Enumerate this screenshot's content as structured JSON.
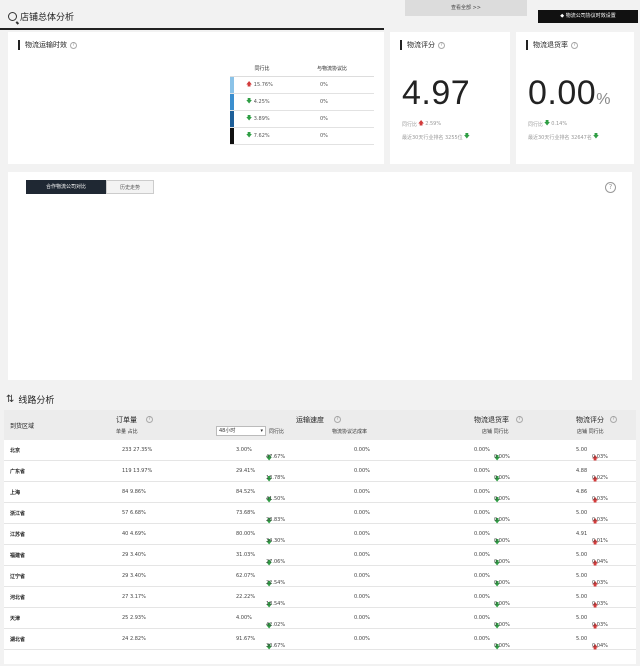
{
  "header": {
    "title": "店铺总体分析",
    "view_all": "查看全部 >>",
    "settings": "物流公司协议时效设置"
  },
  "transport": {
    "title": "物流运输时效",
    "help": "?",
    "table_headers": [
      "同行比",
      "与物流协议比"
    ],
    "rows": [
      {
        "trend": "up",
        "peer": "15.76%",
        "agreement": "0%",
        "bar_color": "#8bc3e8"
      },
      {
        "trend": "down",
        "peer": "4.25%",
        "agreement": "0%",
        "bar_color": "#3b8fcf"
      },
      {
        "trend": "down",
        "peer": "3.89%",
        "agreement": "0%",
        "bar_color": "#1e5f99"
      },
      {
        "trend": "down",
        "peer": "7.62%",
        "agreement": "0%",
        "bar_color": "#111111"
      }
    ]
  },
  "rating": {
    "title": "物流评分",
    "value": "4.97",
    "peer_label": "同行比",
    "peer_value": "2.59%",
    "rank_label": "最近30天行业排名 3255位"
  },
  "return_rate": {
    "title": "物流退货率",
    "value": "0.00",
    "unit": "%",
    "peer_label": "同行比",
    "peer_value": "0.14%",
    "rank_label": "最近30天行业排名 32647名"
  },
  "tabs": {
    "compare": "合作物流公司对比",
    "history": "历史走势"
  },
  "routes": {
    "title": "线路分析",
    "headers": {
      "region": "到货区域",
      "orders": "订单量",
      "orders_sub": "单量 占比",
      "speed": "运输速度",
      "speed_select": "48小时",
      "peer_ratio": "同行比",
      "agreement_rate": "物流协议达成率",
      "return_rate": "物流退货率",
      "store_peer": "店铺 同行比",
      "score": "物流评分",
      "store_peer2": "店铺 同行比"
    },
    "rows": [
      {
        "region": "北京",
        "orders": "233 27.35%",
        "speed": "3.00%",
        "speed_trend": "down",
        "speed_peer": "47.67%",
        "agree": "0.00%",
        "ret": "0.00%",
        "ret_trend": "down",
        "ret_peer": "0.00%",
        "score": "5.00",
        "score_trend": "up",
        "score_peer": "0.03%"
      },
      {
        "region": "广东省",
        "orders": "119 13.97%",
        "speed": "29.41%",
        "speed_trend": "down",
        "speed_peer": "13.78%",
        "agree": "0.00%",
        "ret": "0.00%",
        "ret_trend": "down",
        "ret_peer": "0.00%",
        "score": "4.88",
        "score_trend": "up",
        "score_peer": "0.02%"
      },
      {
        "region": "上海",
        "orders": "84 9.86%",
        "speed": "84.52%",
        "speed_trend": "down",
        "speed_peer": "41.50%",
        "agree": "0.00%",
        "ret": "0.00%",
        "ret_trend": "down",
        "ret_peer": "0.00%",
        "score": "4.86",
        "score_trend": "up",
        "score_peer": "0.03%"
      },
      {
        "region": "浙江省",
        "orders": "57 6.68%",
        "speed": "73.68%",
        "speed_trend": "down",
        "speed_peer": "28.83%",
        "agree": "0.00%",
        "ret": "0.00%",
        "ret_trend": "down",
        "ret_peer": "0.00%",
        "score": "5.00",
        "score_trend": "up",
        "score_peer": "0.03%"
      },
      {
        "region": "江苏省",
        "orders": "40 4.69%",
        "speed": "80.00%",
        "speed_trend": "down",
        "speed_peer": "34.30%",
        "agree": "0.00%",
        "ret": "0.00%",
        "ret_trend": "down",
        "ret_peer": "0.00%",
        "score": "4.91",
        "score_trend": "up",
        "score_peer": "0.01%"
      },
      {
        "region": "福建省",
        "orders": "29 3.40%",
        "speed": "31.03%",
        "speed_trend": "down",
        "speed_peer": "27.06%",
        "agree": "0.00%",
        "ret": "0.00%",
        "ret_trend": "down",
        "ret_peer": "0.00%",
        "score": "5.00",
        "score_trend": "up",
        "score_peer": "0.04%"
      },
      {
        "region": "辽宁省",
        "orders": "29 3.40%",
        "speed": "62.07%",
        "speed_trend": "down",
        "speed_peer": "22.54%",
        "agree": "0.00%",
        "ret": "0.00%",
        "ret_trend": "down",
        "ret_peer": "0.00%",
        "score": "5.00",
        "score_trend": "up",
        "score_peer": "0.03%"
      },
      {
        "region": "河北省",
        "orders": "27 3.17%",
        "speed": "22.22%",
        "speed_trend": "down",
        "speed_peer": "18.54%",
        "agree": "0.00%",
        "ret": "0.00%",
        "ret_trend": "down",
        "ret_peer": "0.00%",
        "score": "5.00",
        "score_trend": "up",
        "score_peer": "0.03%"
      },
      {
        "region": "天津",
        "orders": "25 2.93%",
        "speed": "4.00%",
        "speed_trend": "down",
        "speed_peer": "42.02%",
        "agree": "0.00%",
        "ret": "0.00%",
        "ret_trend": "down",
        "ret_peer": "0.00%",
        "score": "5.00",
        "score_trend": "up",
        "score_peer": "0.03%"
      },
      {
        "region": "湖北省",
        "orders": "24 2.82%",
        "speed": "91.67%",
        "speed_trend": "down",
        "speed_peer": "30.67%",
        "agree": "0.00%",
        "ret": "0.00%",
        "ret_trend": "down",
        "ret_peer": "0.00%",
        "score": "5.00",
        "score_trend": "up",
        "score_peer": "0.04%"
      }
    ]
  }
}
